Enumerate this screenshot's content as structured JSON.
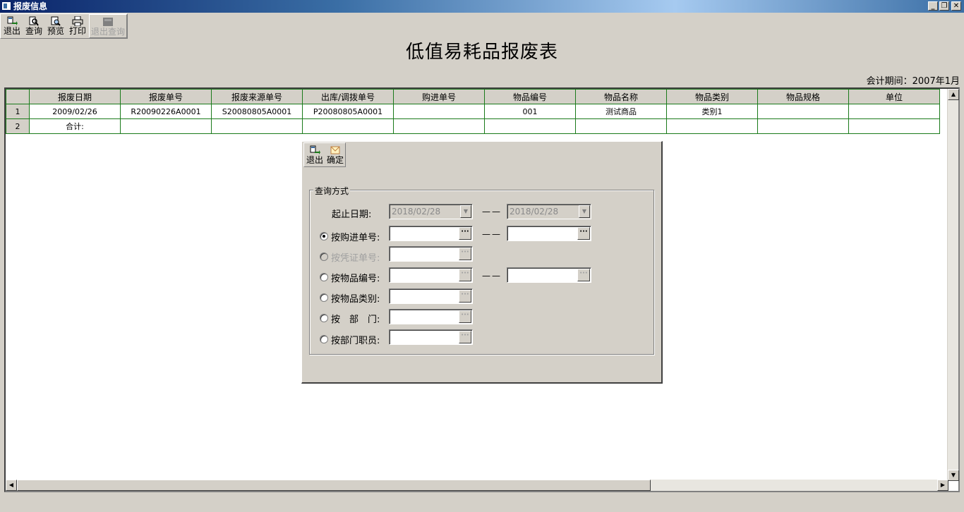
{
  "window": {
    "title": "报废信息"
  },
  "toolbar": {
    "items": [
      {
        "label": "退出",
        "icon": "exit-icon"
      },
      {
        "label": "查询",
        "icon": "search-icon"
      },
      {
        "label": "预览",
        "icon": "preview-icon"
      },
      {
        "label": "打印",
        "icon": "print-icon"
      },
      {
        "label": "退出查询",
        "icon": "exit-query-icon",
        "disabled": true
      }
    ]
  },
  "report": {
    "title": "低值易耗品报废表",
    "period_label": "会计期间：",
    "period_value": "2007年1月"
  },
  "grid": {
    "columns": [
      "报废日期",
      "报废单号",
      "报废来源单号",
      "出库/调拨单号",
      "购进单号",
      "物品编号",
      "物品名称",
      "物品类别",
      "物品规格",
      "单位"
    ],
    "rows": [
      {
        "num": "1",
        "cells": [
          "2009/02/26",
          "R20090226A0001",
          "S20080805A0001",
          "P20080805A0001",
          "",
          "001",
          "测试商品",
          "类别1",
          "",
          ""
        ]
      },
      {
        "num": "2",
        "cells": [
          "合计:",
          "",
          "",
          "",
          "",
          "",
          "",
          "",
          "",
          ""
        ]
      }
    ]
  },
  "dialog": {
    "toolbar": [
      {
        "label": "退出",
        "icon": "exit-icon"
      },
      {
        "label": "确定",
        "icon": "confirm-icon"
      }
    ],
    "group_title": "查询方式",
    "separator": "——",
    "date_row": {
      "label": "起止日期:",
      "start": "2018/02/28",
      "end": "2018/02/28"
    },
    "options": [
      {
        "label": "按购进单号:",
        "checked": true,
        "disabled": false,
        "range": true
      },
      {
        "label": "按凭证单号:",
        "checked": false,
        "disabled": true,
        "range": false
      },
      {
        "label": "按物品编号:",
        "checked": false,
        "disabled": false,
        "range": true
      },
      {
        "label": "按物品类别:",
        "checked": false,
        "disabled": false,
        "range": false
      },
      {
        "label": "按　部　门:",
        "checked": false,
        "disabled": false,
        "range": false
      },
      {
        "label": "按部门职员:",
        "checked": false,
        "disabled": false,
        "range": false
      }
    ],
    "ellipsis": "···"
  }
}
